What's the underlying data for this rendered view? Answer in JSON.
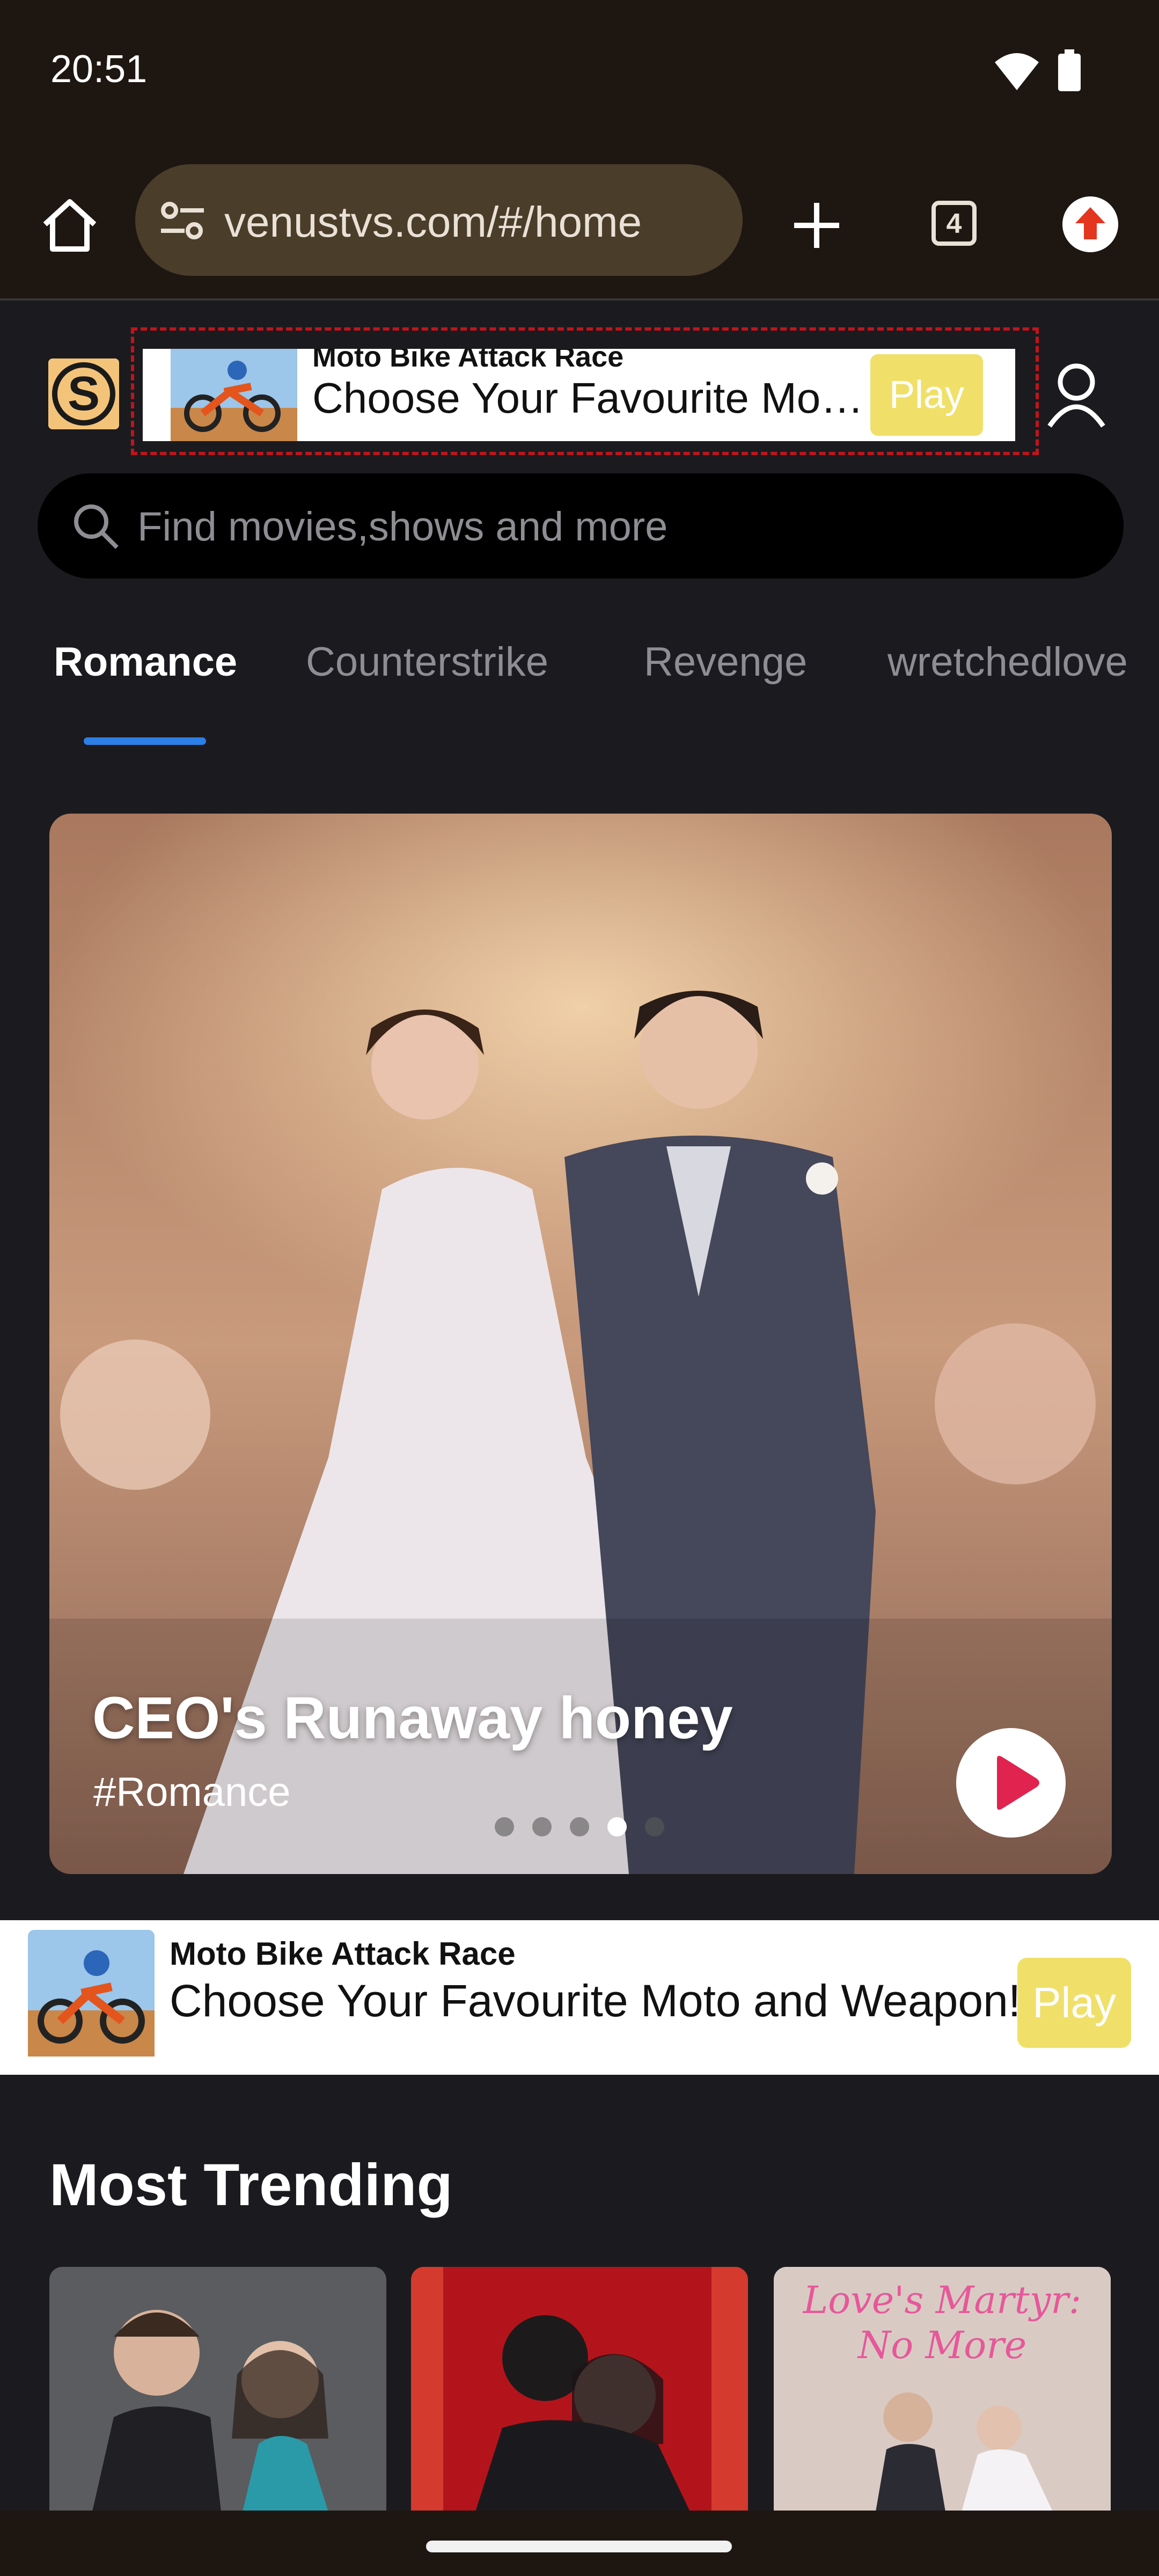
{
  "status_bar": {
    "time": "20:51"
  },
  "browser": {
    "url": "venustvs.com/#/home",
    "tab_count": "4"
  },
  "site": {
    "logo_letter": "S"
  },
  "ad_top": {
    "title": "Moto Bike Attack Race",
    "text": "Choose Your Favourite Moto and Weapon!",
    "play_label": "Play"
  },
  "search": {
    "placeholder": "Find movies,shows and more"
  },
  "category_tabs": [
    {
      "label": "Romance",
      "active": true
    },
    {
      "label": "Counterstrike",
      "active": false
    },
    {
      "label": "Revenge",
      "active": false
    },
    {
      "label": "wretchedlove",
      "active": false
    }
  ],
  "hero": {
    "title": "CEO's Runaway honey",
    "tag": "#Romance",
    "slide_count": 5,
    "active_slide": 4
  },
  "ad_bottom": {
    "title": "Moto Bike Attack Race",
    "text": "Choose Your Favourite Moto and Weapon!",
    "play_label": "Play"
  },
  "trending": {
    "title": "Most Trending",
    "posters": [
      {
        "caption": ""
      },
      {
        "caption": ""
      },
      {
        "caption": "Love's Martyr: No More"
      }
    ]
  },
  "colors": {
    "accent_blue": "#2c7fe6",
    "play_red": "#e0244f",
    "ad_play_yellow": "#f0e06a",
    "page_bg": "#1b1b1f"
  }
}
